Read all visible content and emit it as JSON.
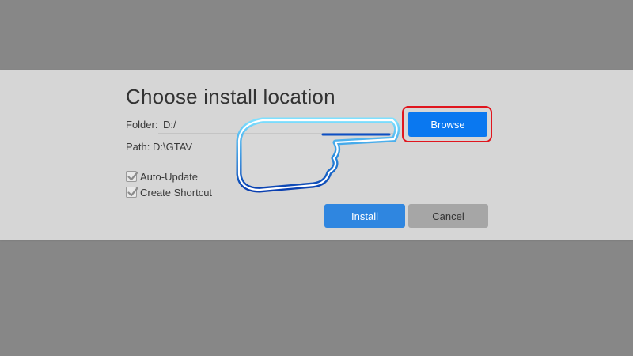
{
  "dialog": {
    "title": "Choose install location",
    "folder_label": "Folder:",
    "folder_value": "D:/",
    "path_label": "Path:",
    "path_value": "D:\\GTAV",
    "browse_label": "Browse",
    "options": [
      {
        "label": "Auto-Update",
        "checked": true
      },
      {
        "label": "Create Shortcut",
        "checked": true
      }
    ],
    "install_label": "Install",
    "cancel_label": "Cancel"
  },
  "annotation": {
    "pointer_icon": "pointing-hand-icon",
    "highlight_color": "#e0161e"
  },
  "colors": {
    "browse_button": "#0a78f0",
    "install_button": "#2f86e0",
    "cancel_button": "#a6a6a6",
    "dialog_bg": "#d6d6d6",
    "backdrop": "#878787"
  }
}
